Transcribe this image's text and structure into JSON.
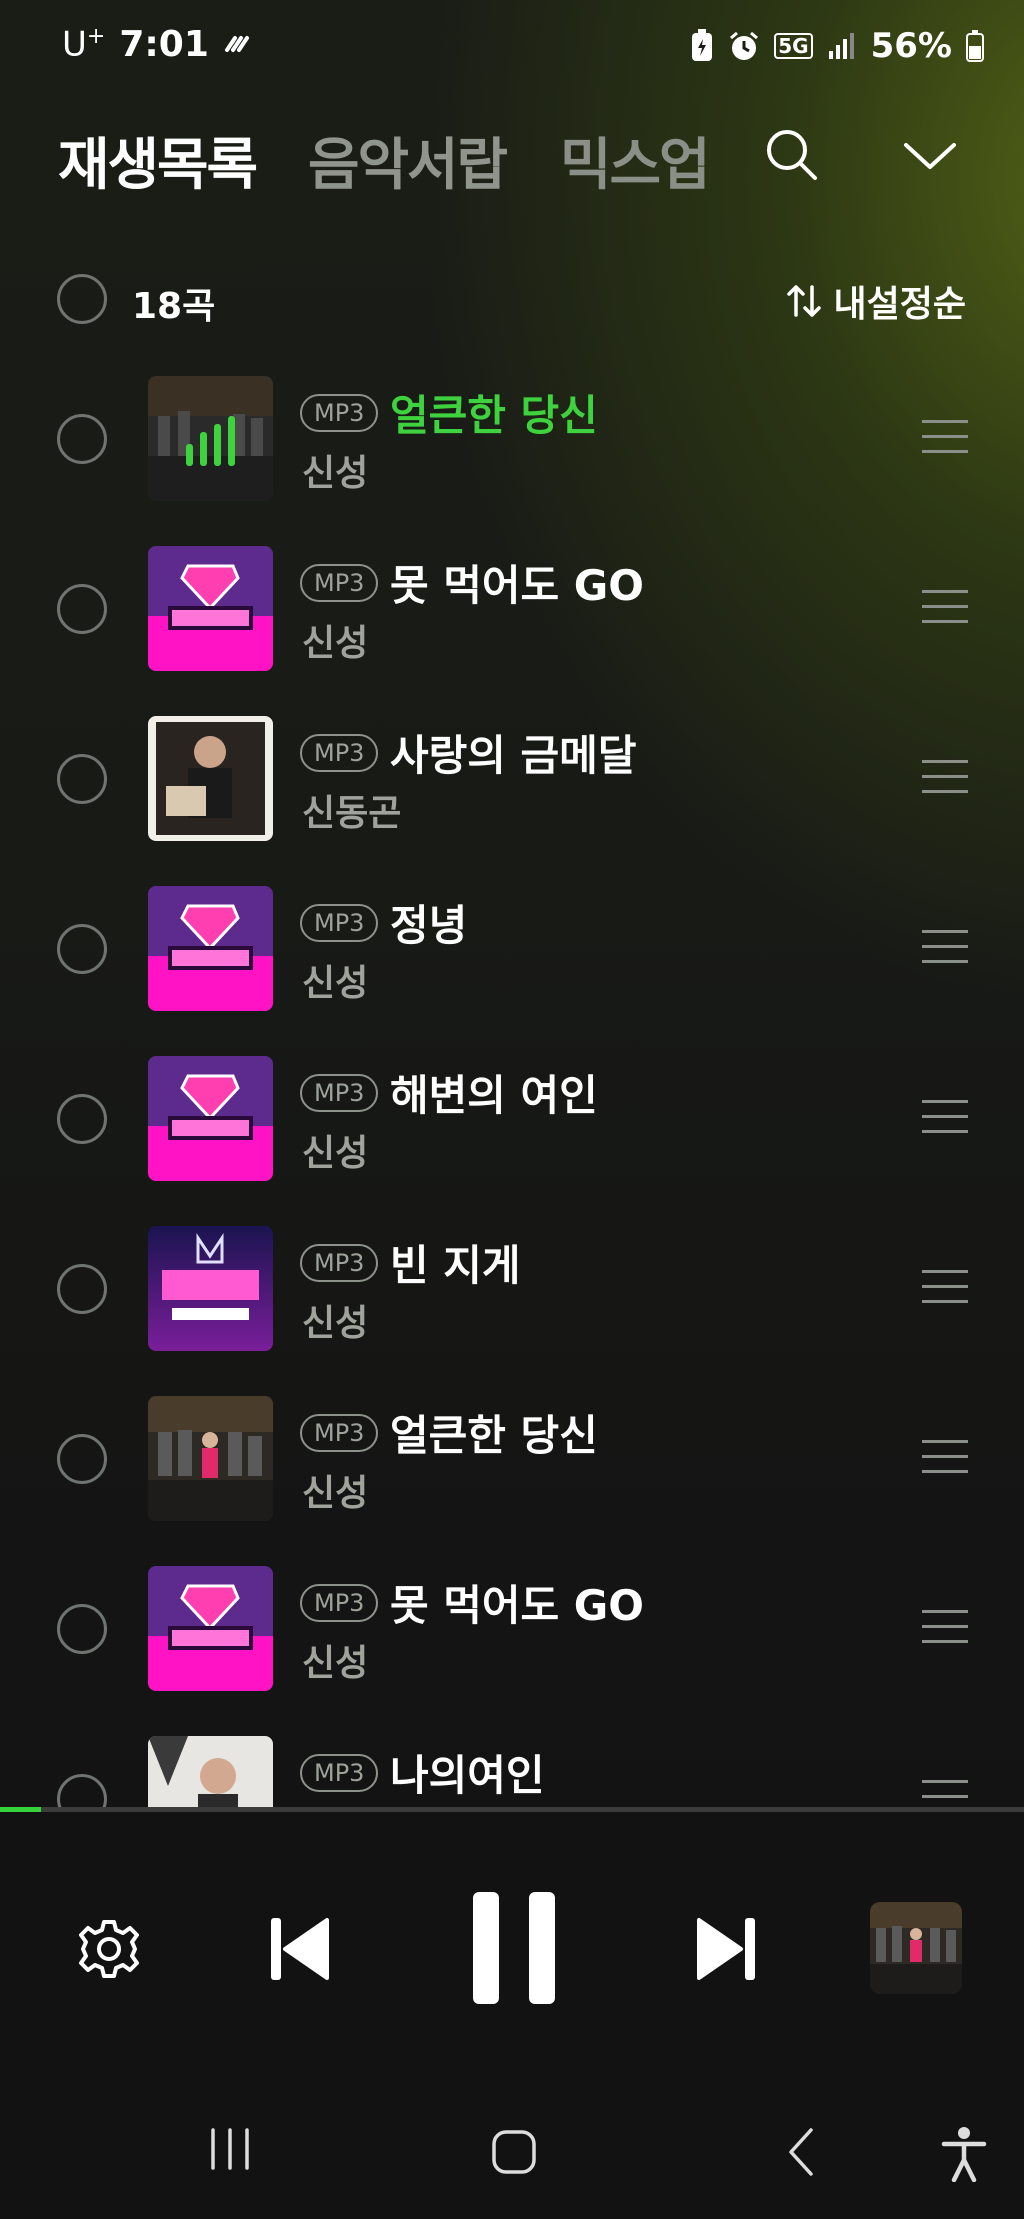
{
  "status_bar": {
    "carrier": "U",
    "carrier_sup": "+",
    "time": "7:01",
    "battery": "56%",
    "network": "5G"
  },
  "tabs": [
    {
      "label": "재생목록",
      "active": true
    },
    {
      "label": "음악서랍",
      "active": false
    },
    {
      "label": "믹스업",
      "active": false
    }
  ],
  "icons": {
    "search": "search-icon",
    "collapse": "chevron-down-icon",
    "sort": "sort-arrows-icon",
    "drag": "drag-handle-icon",
    "settings": "gear-icon",
    "prev": "skip-previous-icon",
    "pause": "pause-icon",
    "next": "skip-next-icon"
  },
  "list_header": {
    "count": "18곡",
    "sort_label": "내설정순"
  },
  "tracks": [
    {
      "format": "MP3",
      "title": "얼큰한 당신",
      "artist": "신성",
      "playing": true
    },
    {
      "format": "MP3",
      "title": "못 먹어도 GO",
      "artist": "신성",
      "playing": false
    },
    {
      "format": "MP3",
      "title": "사랑의 금메달",
      "artist": "신동곤",
      "playing": false
    },
    {
      "format": "MP3",
      "title": "정녕",
      "artist": "신성",
      "playing": false
    },
    {
      "format": "MP3",
      "title": "해변의 여인",
      "artist": "신성",
      "playing": false
    },
    {
      "format": "MP3",
      "title": "빈 지게",
      "artist": "신성",
      "playing": false
    },
    {
      "format": "MP3",
      "title": "얼큰한 당신",
      "artist": "신성",
      "playing": false
    },
    {
      "format": "MP3",
      "title": "못 먹어도 GO",
      "artist": "신성",
      "playing": false
    },
    {
      "format": "MP3",
      "title": "나의여인",
      "artist": "",
      "playing": false
    }
  ],
  "player": {
    "progress": 0.04
  },
  "colors": {
    "accent": "#3ed33e",
    "background": "#121212",
    "muted_text": "#9fa39c"
  }
}
